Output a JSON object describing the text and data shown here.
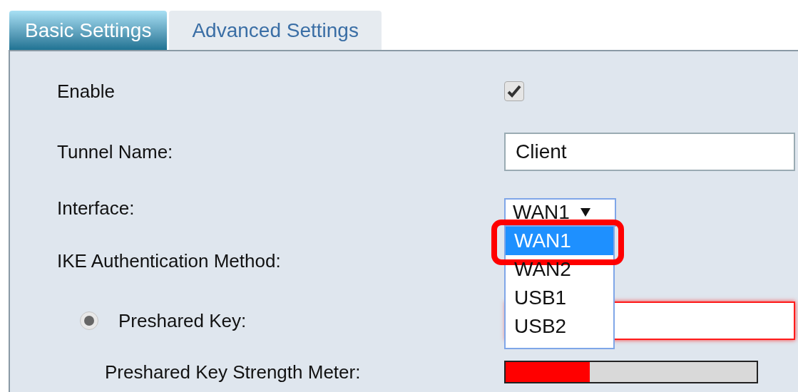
{
  "tabs": [
    {
      "label": "Basic Settings",
      "selected": true
    },
    {
      "label": "Advanced Settings",
      "selected": false
    }
  ],
  "form": {
    "enable": {
      "label": "Enable",
      "checked": true
    },
    "tunnel_name": {
      "label": "Tunnel Name:",
      "value": "Client"
    },
    "interface": {
      "label": "Interface:",
      "value": "WAN1",
      "expanded": true,
      "options": [
        {
          "label": "WAN1",
          "selected": true,
          "highlighted": true
        },
        {
          "label": "WAN2",
          "selected": false,
          "highlighted": false
        },
        {
          "label": "USB1",
          "selected": false,
          "highlighted": false
        },
        {
          "label": "USB2",
          "selected": false,
          "highlighted": false
        }
      ]
    },
    "ike_method": {
      "label": "IKE Authentication Method:"
    },
    "preshared_key": {
      "label": "Preshared Key:",
      "selected": true,
      "invalid": true
    },
    "strength_meter": {
      "label": "Preshared Key Strength Meter:",
      "level": 0.335
    }
  }
}
